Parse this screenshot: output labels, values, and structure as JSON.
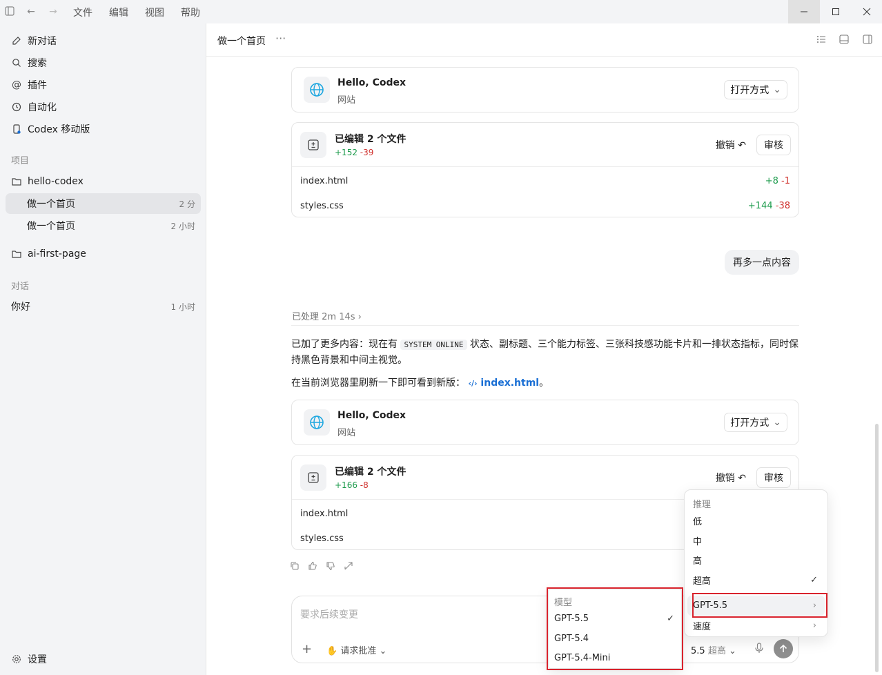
{
  "titlebar": {
    "menus": [
      "文件",
      "编辑",
      "视图",
      "帮助"
    ]
  },
  "sidebar": {
    "top_items": [
      {
        "label": "新对话",
        "icon": "new-chat-icon"
      },
      {
        "label": "搜索",
        "icon": "search-icon"
      },
      {
        "label": "插件",
        "icon": "plugin-icon"
      },
      {
        "label": "自动化",
        "icon": "clock-icon"
      },
      {
        "label": "Codex 移动版",
        "icon": "mobile-icon"
      }
    ],
    "projects_heading": "项目",
    "projects": [
      {
        "name": "hello-codex",
        "threads": [
          {
            "title": "做一个首页",
            "time": "2 分"
          },
          {
            "title": "做一个首页",
            "time": "2 小时"
          }
        ]
      },
      {
        "name": "ai-first-page"
      }
    ],
    "chats_heading": "对话",
    "chats": [
      {
        "title": "你好",
        "time": "1 小时"
      }
    ],
    "settings_label": "设置"
  },
  "header": {
    "title": "做一个首页",
    "more": "···"
  },
  "cards": {
    "site1": {
      "title": "Hello, Codex",
      "subtitle": "网站",
      "open_label": "打开方式"
    },
    "edit1": {
      "title": "已编辑 2 个文件",
      "plus": "+152",
      "minus": "-39",
      "undo": "撤销",
      "review": "审核",
      "files": [
        {
          "name": "index.html",
          "plus": "+8",
          "minus": "-1"
        },
        {
          "name": "styles.css",
          "plus": "+144",
          "minus": "-38"
        }
      ]
    },
    "site2": {
      "title": "Hello, Codex",
      "subtitle": "网站",
      "open_label": "打开方式"
    },
    "edit2": {
      "title": "已编辑 2 个文件",
      "plus": "+166",
      "minus": "-8",
      "undo": "撤销",
      "review": "审核",
      "files": [
        {
          "name": "index.html"
        },
        {
          "name": "styles.css"
        }
      ]
    }
  },
  "user_message": "再多一点内容",
  "processed": "已处理 2m 14s",
  "reply": {
    "p1_a": "已加了更多内容：现在有",
    "p1_code": "SYSTEM ONLINE",
    "p1_b": "状态、副标题、三个能力标签、三张科技感功能卡片和一排状态指标，同时保持黑色背景和中间主视觉。",
    "p2_a": "在当前浏览器里刷新一下即可看到新版：",
    "p2_link": "index.html",
    "p2_b": "。"
  },
  "composer": {
    "placeholder": "要求后续变更",
    "approval": "请求批准",
    "model": "5.5",
    "effort": "超高"
  },
  "reasoning_menu": {
    "heading": "推理",
    "items": [
      "低",
      "中",
      "高",
      "超高"
    ],
    "selected": "超高",
    "model_item": "GPT-5.5",
    "speed_item": "速度"
  },
  "model_menu": {
    "heading": "模型",
    "items": [
      "GPT-5.5",
      "GPT-5.4",
      "GPT-5.4-Mini"
    ],
    "selected": "GPT-5.5"
  },
  "colors": {
    "added": "#1a9a4a",
    "removed": "#d0312d",
    "highlight": "#d9232d",
    "link": "#1a6fd4"
  }
}
